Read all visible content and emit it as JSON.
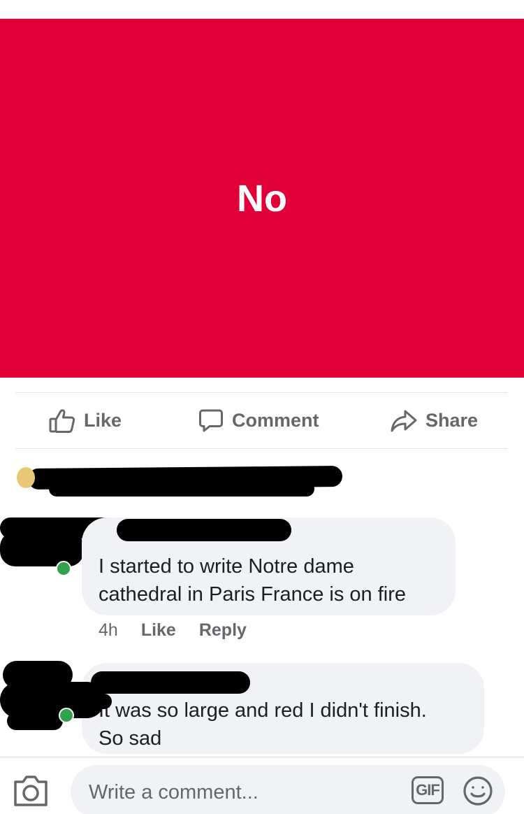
{
  "post": {
    "card_text": "No",
    "card_color": "#e00037"
  },
  "actions": {
    "like_label": "Like",
    "comment_label": "Comment",
    "share_label": "Share"
  },
  "comments": [
    {
      "author": "",
      "lines": [
        "I started to write  Notre dame",
        "cathedral in Paris France is on fire"
      ],
      "time": "4h",
      "like_label": "Like",
      "reply_label": "Reply"
    },
    {
      "author": "",
      "lines": [
        "It was so large and red I didn't finish.",
        "So sad"
      ]
    }
  ],
  "composer": {
    "placeholder": "Write a comment...",
    "gif_label": "GIF",
    "camera_icon": "camera-icon",
    "emoji_icon": "emoji-icon"
  },
  "colors": {
    "muted": "#65676b",
    "bubble": "#f0f2f5",
    "online": "#31a24c"
  }
}
